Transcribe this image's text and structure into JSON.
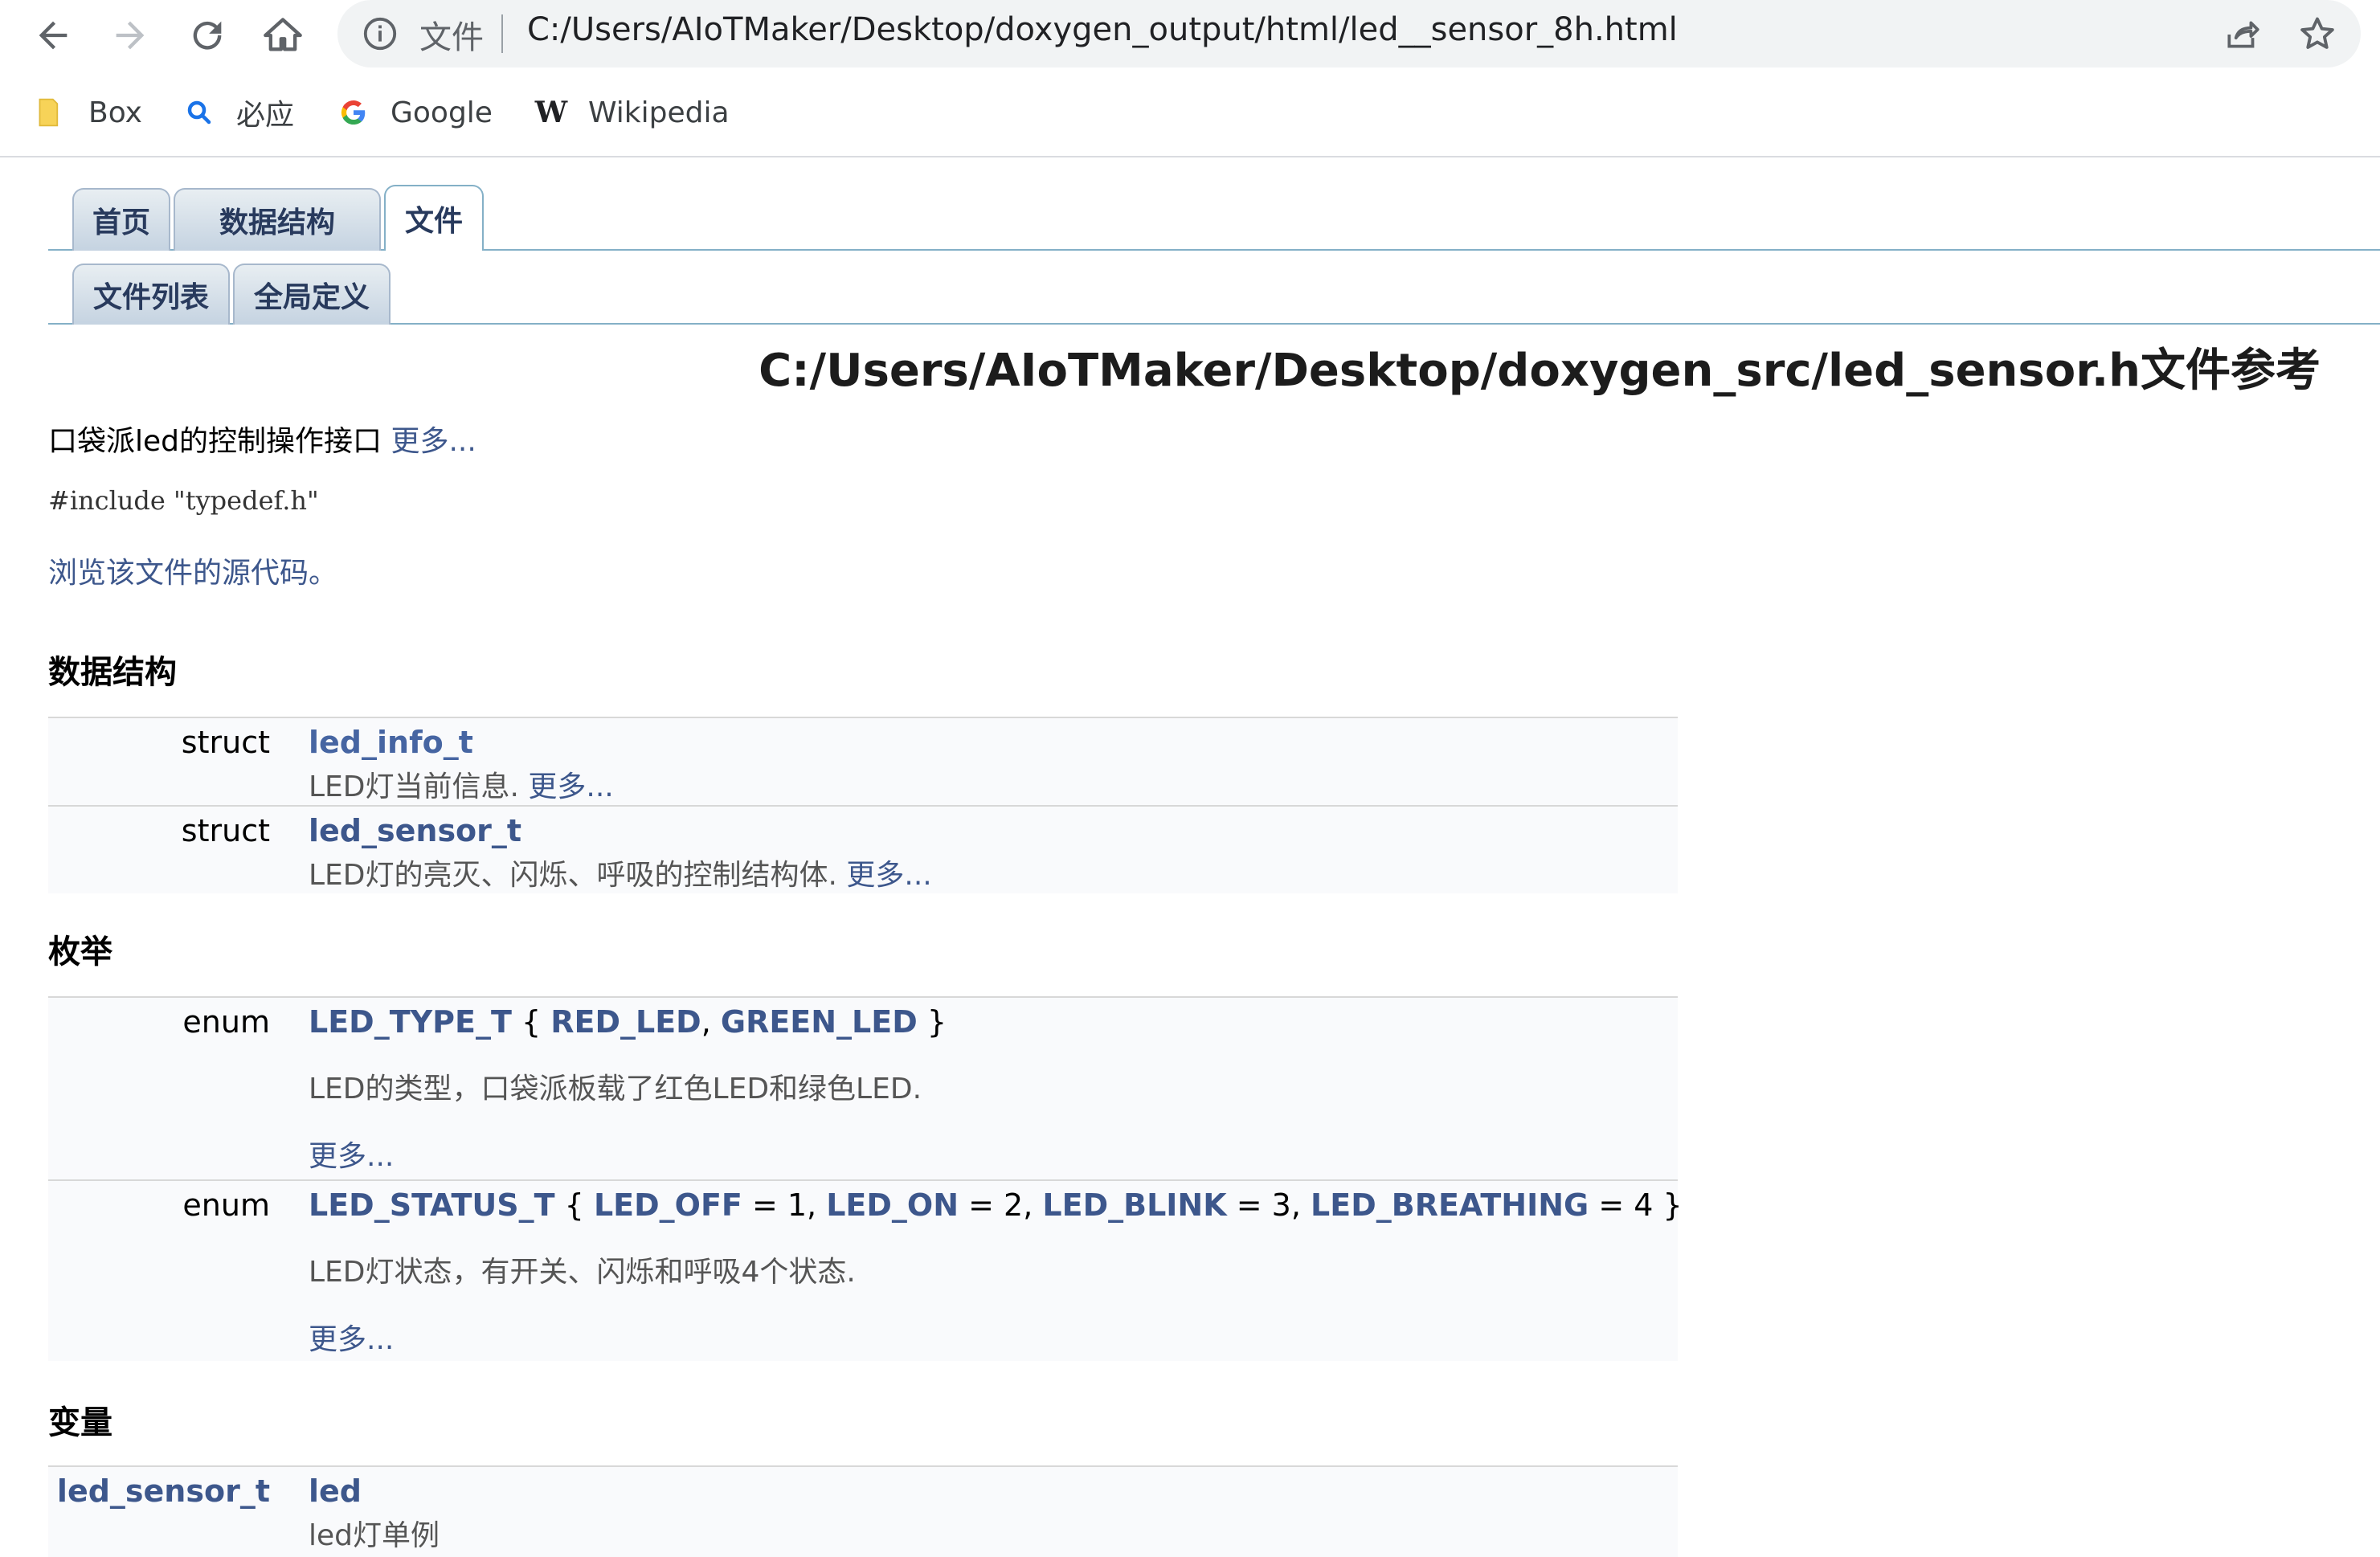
{
  "browser": {
    "scheme_label": "文件",
    "url": "C:/Users/AIoTMaker/Desktop/doxygen_output/html/led__sensor_8h.html",
    "icons": [
      "back-icon",
      "forward-icon",
      "reload-icon",
      "home-icon",
      "info-icon",
      "share-icon",
      "star-icon"
    ]
  },
  "bookmarks": [
    {
      "label": "Box",
      "icon": "folder-icon"
    },
    {
      "label": "必应",
      "icon": "search-icon"
    },
    {
      "label": "Google",
      "icon": "google-icon"
    },
    {
      "label": "Wikipedia",
      "icon": "wikipedia-icon"
    }
  ],
  "tabs": {
    "main": [
      "首页",
      "数据结构",
      "文件"
    ],
    "sub": [
      "文件列表",
      "全局定义"
    ]
  },
  "page": {
    "title": "C:/Users/AIoTMaker/Desktop/doxygen_src/led_sensor.h文件参考",
    "brief": "口袋派led的控制操作接口",
    "more": "更多...",
    "include": "#include \"typedef.h\"",
    "source_link": "浏览该文件的源代码。"
  },
  "sections": {
    "data_structures": {
      "heading": "数据结构",
      "rows": [
        {
          "kind": "struct",
          "name": "led_info_t",
          "desc": "LED灯当前信息.",
          "more": "更多..."
        },
        {
          "kind": "struct",
          "name": "led_sensor_t",
          "desc": "LED灯的亮灭、闪烁、呼吸的控制结构体.",
          "more": "更多..."
        }
      ]
    },
    "enums": {
      "heading": "枚举",
      "rows": [
        {
          "kind": "enum",
          "name": "LED_TYPE_T",
          "open": " { ",
          "values": [
            "RED_LED",
            "GREEN_LED"
          ],
          "close": " }",
          "desc": "LED的类型，口袋派板载了红色LED和绿色LED.",
          "more": "更多..."
        },
        {
          "kind": "enum",
          "name": "LED_STATUS_T",
          "open": " { ",
          "values": [
            "LED_OFF",
            "LED_ON",
            "LED_BLINK",
            "LED_BREATHING"
          ],
          "assigns": [
            " = 1, ",
            " = 2, ",
            " = 3, ",
            " = 4"
          ],
          "close": " }",
          "desc": "LED灯状态，有开关、闪烁和呼吸4个状态.",
          "more": "更多..."
        }
      ]
    },
    "variables": {
      "heading": "变量",
      "rows": [
        {
          "type": "led_sensor_t",
          "name": "led",
          "desc": "led灯单例"
        }
      ]
    }
  }
}
